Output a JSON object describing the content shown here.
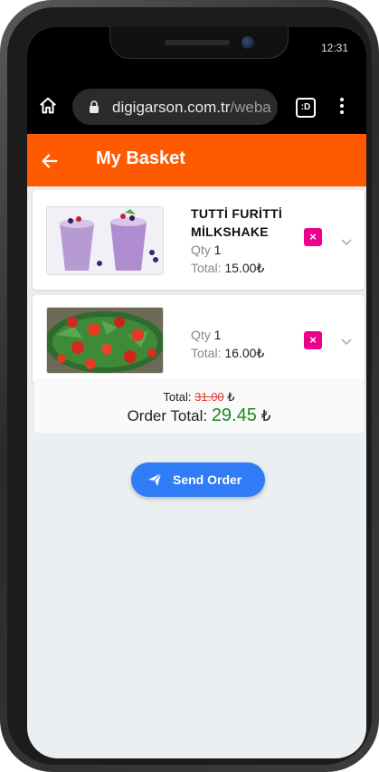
{
  "status_bar": {
    "time": "12:31"
  },
  "browser": {
    "url_main": "digigarson.com.tr",
    "url_rest": "/weba",
    "tab_switcher_label": ":D",
    "home_icon": "home-icon",
    "lock_icon": "lock-icon",
    "menu_icon": "more-vert-icon"
  },
  "app_bar": {
    "title": "My Basket",
    "back_icon": "arrow-left-icon",
    "color": "#ff5a00"
  },
  "basket": {
    "items": [
      {
        "name_line1": "TUTTİ FURİTTİ",
        "name_line2": "MİLKSHAKE",
        "qty_label": "Qty",
        "qty": "1",
        "total_label": "Total:",
        "total": "15.00₺",
        "remove_label": "×",
        "image": "milkshake-photo"
      },
      {
        "name_line1": "",
        "name_line2": "",
        "qty_label": "Qty",
        "qty": "1",
        "total_label": "Total:",
        "total": "16.00₺",
        "remove_label": "×",
        "image": "salad-photo"
      }
    ]
  },
  "summary": {
    "total_label": "Total:",
    "total_old": "31.00",
    "currency": "₺",
    "order_total_label": "Order Total:",
    "order_total": "29.45",
    "old_color": "#e53935",
    "new_color": "#1b8a1b"
  },
  "actions": {
    "send_order_label": "Send Order",
    "send_icon": "send-icon",
    "button_color": "#2f7cf6"
  }
}
